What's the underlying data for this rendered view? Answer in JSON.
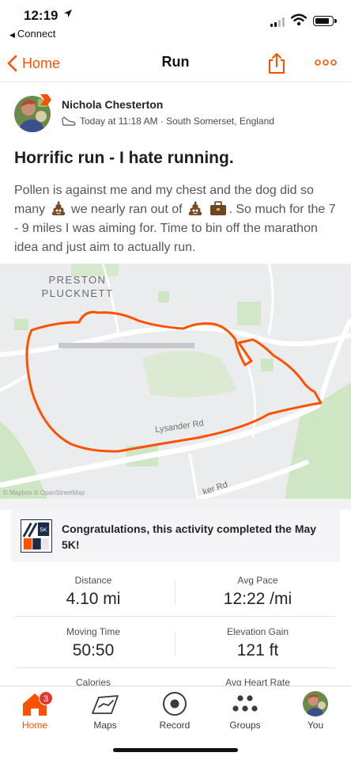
{
  "status_bar": {
    "time": "12:19",
    "back_app": "Connect"
  },
  "nav": {
    "back_label": "Home",
    "title": "Run"
  },
  "athlete": {
    "name": "Nichola Chesterton",
    "meta": "Today at 11:18 AM · South Somerset, England"
  },
  "activity": {
    "title": "Horrific run - I hate running.",
    "desc_1": "Pollen is against me and my chest and the dog did so many",
    "desc_2": "we nearly ran out of",
    "desc_3": ". So much for the 7 - 9 miles I was aiming for. Time to bin off the marathon idea and just aim to actually run."
  },
  "map": {
    "place_line1": "PRESTON",
    "place_line2": "PLUCKNETT",
    "road_1": "Lysander Rd",
    "road_2": "ker Rd",
    "attribution": "© Mapbox © OpenStreetMap",
    "route_color": "#fc5200"
  },
  "challenge": {
    "text": "Congratulations, this activity completed the May 5K!"
  },
  "stats": [
    {
      "label": "Distance",
      "value": "4.10 mi"
    },
    {
      "label": "Avg Pace",
      "value": "12:22 /mi"
    },
    {
      "label": "Moving Time",
      "value": "50:50"
    },
    {
      "label": "Elevation Gain",
      "value": "121 ft"
    },
    {
      "label": "Calories",
      "value": ""
    },
    {
      "label": "Avg Heart Rate",
      "value": ""
    }
  ],
  "tabs": [
    {
      "label": "Home",
      "icon": "home-icon",
      "badge": "3"
    },
    {
      "label": "Maps",
      "icon": "map-icon"
    },
    {
      "label": "Record",
      "icon": "record-icon"
    },
    {
      "label": "Groups",
      "icon": "groups-icon"
    },
    {
      "label": "You",
      "icon": "profile-avatar"
    }
  ],
  "colors": {
    "accent": "#fc5200",
    "badge": "#e3362c",
    "text": "#242428"
  }
}
